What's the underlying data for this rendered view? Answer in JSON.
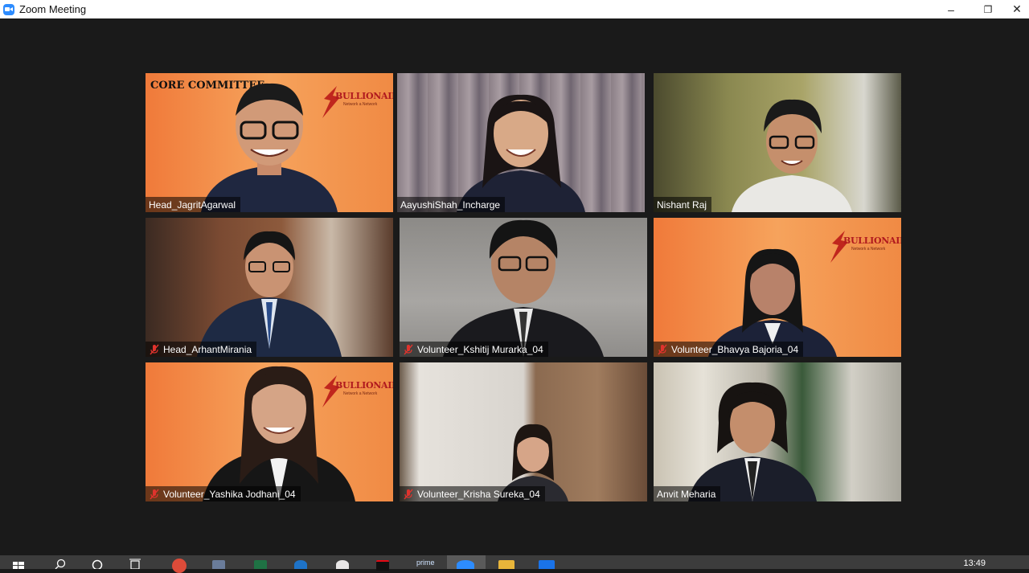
{
  "window": {
    "title": "Zoom Meeting",
    "minimize_glyph": "–",
    "restore_glyph": "❐",
    "close_glyph": "✕"
  },
  "brand": {
    "name": "BULLIONAIRE",
    "tagline": "Network a Network",
    "core_label": "CORE COMMITTEE",
    "accent": "#c9dc5c"
  },
  "participants": [
    {
      "name": "Head_JagritAgarwal",
      "muted": false,
      "active": false,
      "background": "orange-brand",
      "has_core_label": true
    },
    {
      "name": "AayushiShah_Incharge",
      "muted": false,
      "active": true,
      "background": "curtain"
    },
    {
      "name": "Nishant Raj",
      "muted": false,
      "active": false,
      "background": "room-light"
    },
    {
      "name": "Head_ArhantMirania",
      "muted": true,
      "active": false,
      "background": "room-wood"
    },
    {
      "name": "Volunteer_Kshitij Murarka_04",
      "muted": true,
      "active": false,
      "background": "grey-wall"
    },
    {
      "name": "Volunteer_Bhavya Bajoria_04",
      "muted": true,
      "active": false,
      "background": "orange-brand"
    },
    {
      "name": "Volunteer_Yashika Jodhani_04",
      "muted": true,
      "active": false,
      "background": "orange-brand"
    },
    {
      "name": "Volunteer_Krisha Sureka_04",
      "muted": true,
      "active": false,
      "background": "curtain-light"
    },
    {
      "name": "Anvit Meharia",
      "muted": false,
      "active": false,
      "background": "room-window"
    }
  ],
  "taskbar": {
    "clock": "13:49",
    "icons": [
      "windows-start-icon",
      "search-icon",
      "cortana-icon",
      "task-view-icon",
      "chrome-icon",
      "calculator-icon",
      "excel-icon",
      "edge-icon",
      "paint-icon",
      "netflix-icon",
      "prime-video-icon",
      "zoom-icon",
      "file-explorer-icon",
      "mail-icon"
    ],
    "prime_label": "prime"
  }
}
